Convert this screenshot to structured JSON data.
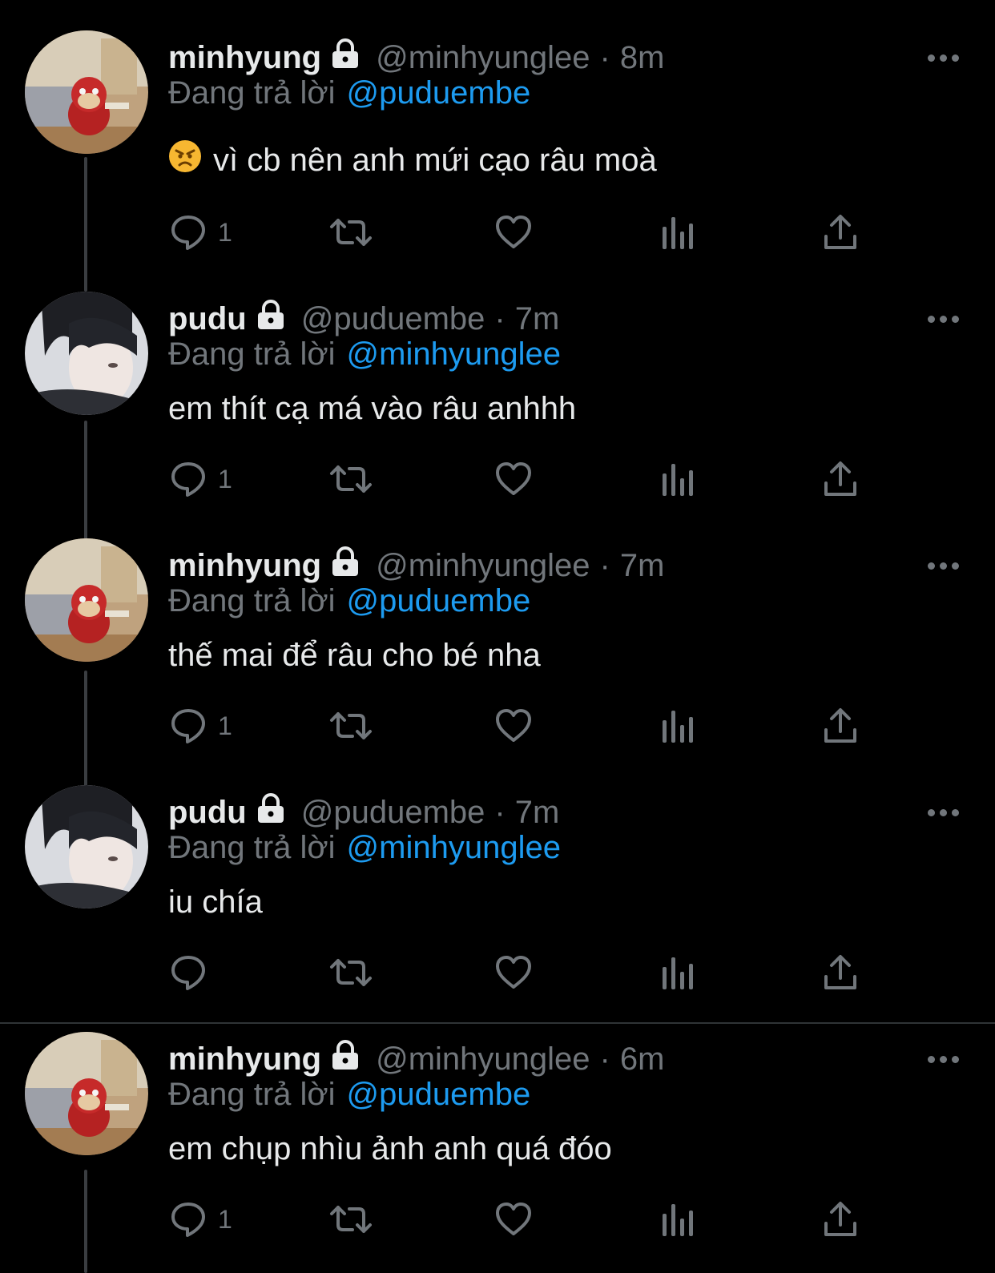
{
  "colors": {
    "background": "#000000",
    "name": "#e7e9ea",
    "secondary": "#71767b",
    "mention": "#1d9bf0",
    "thread_line": "#3a3d41",
    "divider": "#2f3336"
  },
  "icons": {
    "lock": "lock-icon",
    "more": "more-icon",
    "reply": "reply-icon",
    "retweet": "retweet-icon",
    "like": "heart-icon",
    "views": "views-icon",
    "share": "share-icon"
  },
  "tweets": [
    {
      "name": "minhyung",
      "handle": "@minhyunglee",
      "dot": "·",
      "time": "8m",
      "reply_prefix": "Đang trả lời",
      "reply_to": "@puduembe",
      "emoji": "😠",
      "text": "vì cb nên anh mứi cạo râu moà",
      "reply_count": "1"
    },
    {
      "name": "pudu",
      "handle": "@puduembe",
      "dot": "·",
      "time": "7m",
      "reply_prefix": "Đang trả lời",
      "reply_to": "@minhyunglee",
      "text": "em thít cạ má vào râu anhhh",
      "reply_count": "1"
    },
    {
      "name": "minhyung",
      "handle": "@minhyunglee",
      "dot": "·",
      "time": "7m",
      "reply_prefix": "Đang trả lời",
      "reply_to": "@puduembe",
      "text": "thế mai để râu cho bé nha",
      "reply_count": "1"
    },
    {
      "name": "pudu",
      "handle": "@puduembe",
      "dot": "·",
      "time": "7m",
      "reply_prefix": "Đang trả lời",
      "reply_to": "@minhyunglee",
      "text": "iu chía",
      "reply_count": ""
    },
    {
      "name": "minhyung",
      "handle": "@minhyunglee",
      "dot": "·",
      "time": "6m",
      "reply_prefix": "Đang trả lời",
      "reply_to": "@puduembe",
      "text": "em chụp nhìu ảnh anh quá đóo",
      "reply_count": "1"
    }
  ]
}
